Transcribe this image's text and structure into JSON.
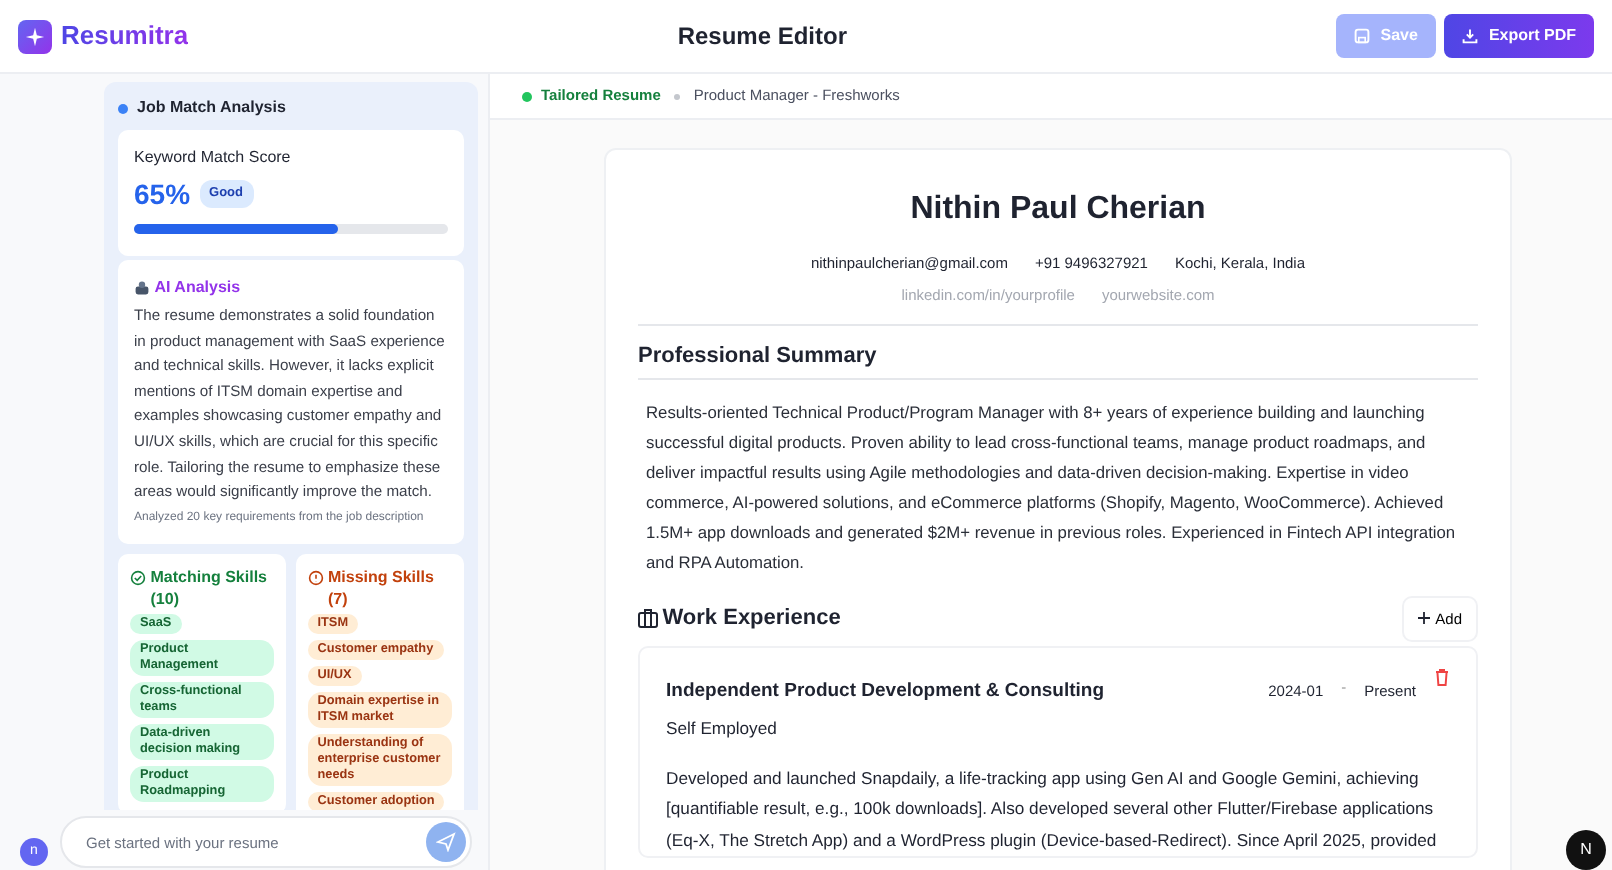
{
  "app": {
    "name": "Resumitra"
  },
  "header": {
    "title": "Resume Editor",
    "buttons": [
      {
        "label": "Save",
        "kind": "save",
        "disabled": true
      },
      {
        "label": "Export PDF",
        "kind": "export",
        "disabled": false
      }
    ]
  },
  "sidebar": {
    "title": "Job Match Analysis",
    "score": {
      "label": "Keyword Match Score",
      "value": "65%",
      "rating": "Good",
      "level": 0.65
    },
    "ai_analysis": {
      "title": "AI Analysis",
      "text": "The resume demonstrates a solid foundation in product management with SaaS experience and technical skills. However, it lacks explicit mentions of ITSM domain expertise and examples showcasing customer empathy and UI/UX skills, which are crucial for this specific role. Tailoring the resume to emphasize these areas would significantly improve the match.",
      "footnote": "Analyzed 20 key requirements from the job description"
    },
    "skill_groups": [
      {
        "kind": "matching",
        "title": "Matching Skills (10)",
        "items": [
          "SaaS",
          "Product Management",
          "Cross-functional teams",
          "Data-driven decision making",
          "Product Roadmapping"
        ]
      },
      {
        "kind": "missing",
        "title": "Missing Skills (7)",
        "items": [
          "ITSM",
          "Customer empathy",
          "UI/UX",
          "Domain expertise in ITSM market",
          "Understanding of enterprise customer needs",
          "Customer adoption"
        ]
      }
    ],
    "chat": {
      "placeholder": "Get started with your resume"
    },
    "avatar": "n"
  },
  "breadcrumb": {
    "status": "Tailored Resume",
    "job": "Product Manager - Freshworks"
  },
  "resume": {
    "name": "Nithin Paul Cherian",
    "contacts": [
      "nithinpaulcherian@gmail.com",
      "+91 9496327921",
      "Kochi, Kerala, India"
    ],
    "links": [
      "linkedin.com/in/yourprofile",
      "yourwebsite.com"
    ],
    "summary": {
      "title": "Professional Summary",
      "text": "Results-oriented Technical Product/Program Manager with 8+ years of experience building and launching successful digital products. Proven ability to lead cross-functional teams, manage product roadmaps, and deliver impactful results using Agile methodologies and data-driven decision-making. Expertise in video commerce, AI-powered solutions, and eCommerce platforms (Shopify, Magento, WooCommerce). Achieved 1.5M+ app downloads and generated $2M+ revenue in previous roles. Experienced in Fintech API integration and RPA Automation."
    },
    "experience": {
      "title": "Work Experience",
      "add_label": "Add",
      "entries": [
        {
          "title": "Independent Product Development & Consulting",
          "start": "2024-01",
          "separator": "-",
          "end": "Present",
          "company": "Self Employed",
          "description": "Developed and launched Snapdaily, a life-tracking app using Gen AI and Google Gemini, achieving [quantifiable result, e.g., 100k downloads]. Also developed several other Flutter/Firebase applications (Eq-X, The Stretch App) and a WordPress plugin (Device-based-Redirect). Since April 2025, provided"
        }
      ]
    }
  },
  "dev_badge": "N"
}
